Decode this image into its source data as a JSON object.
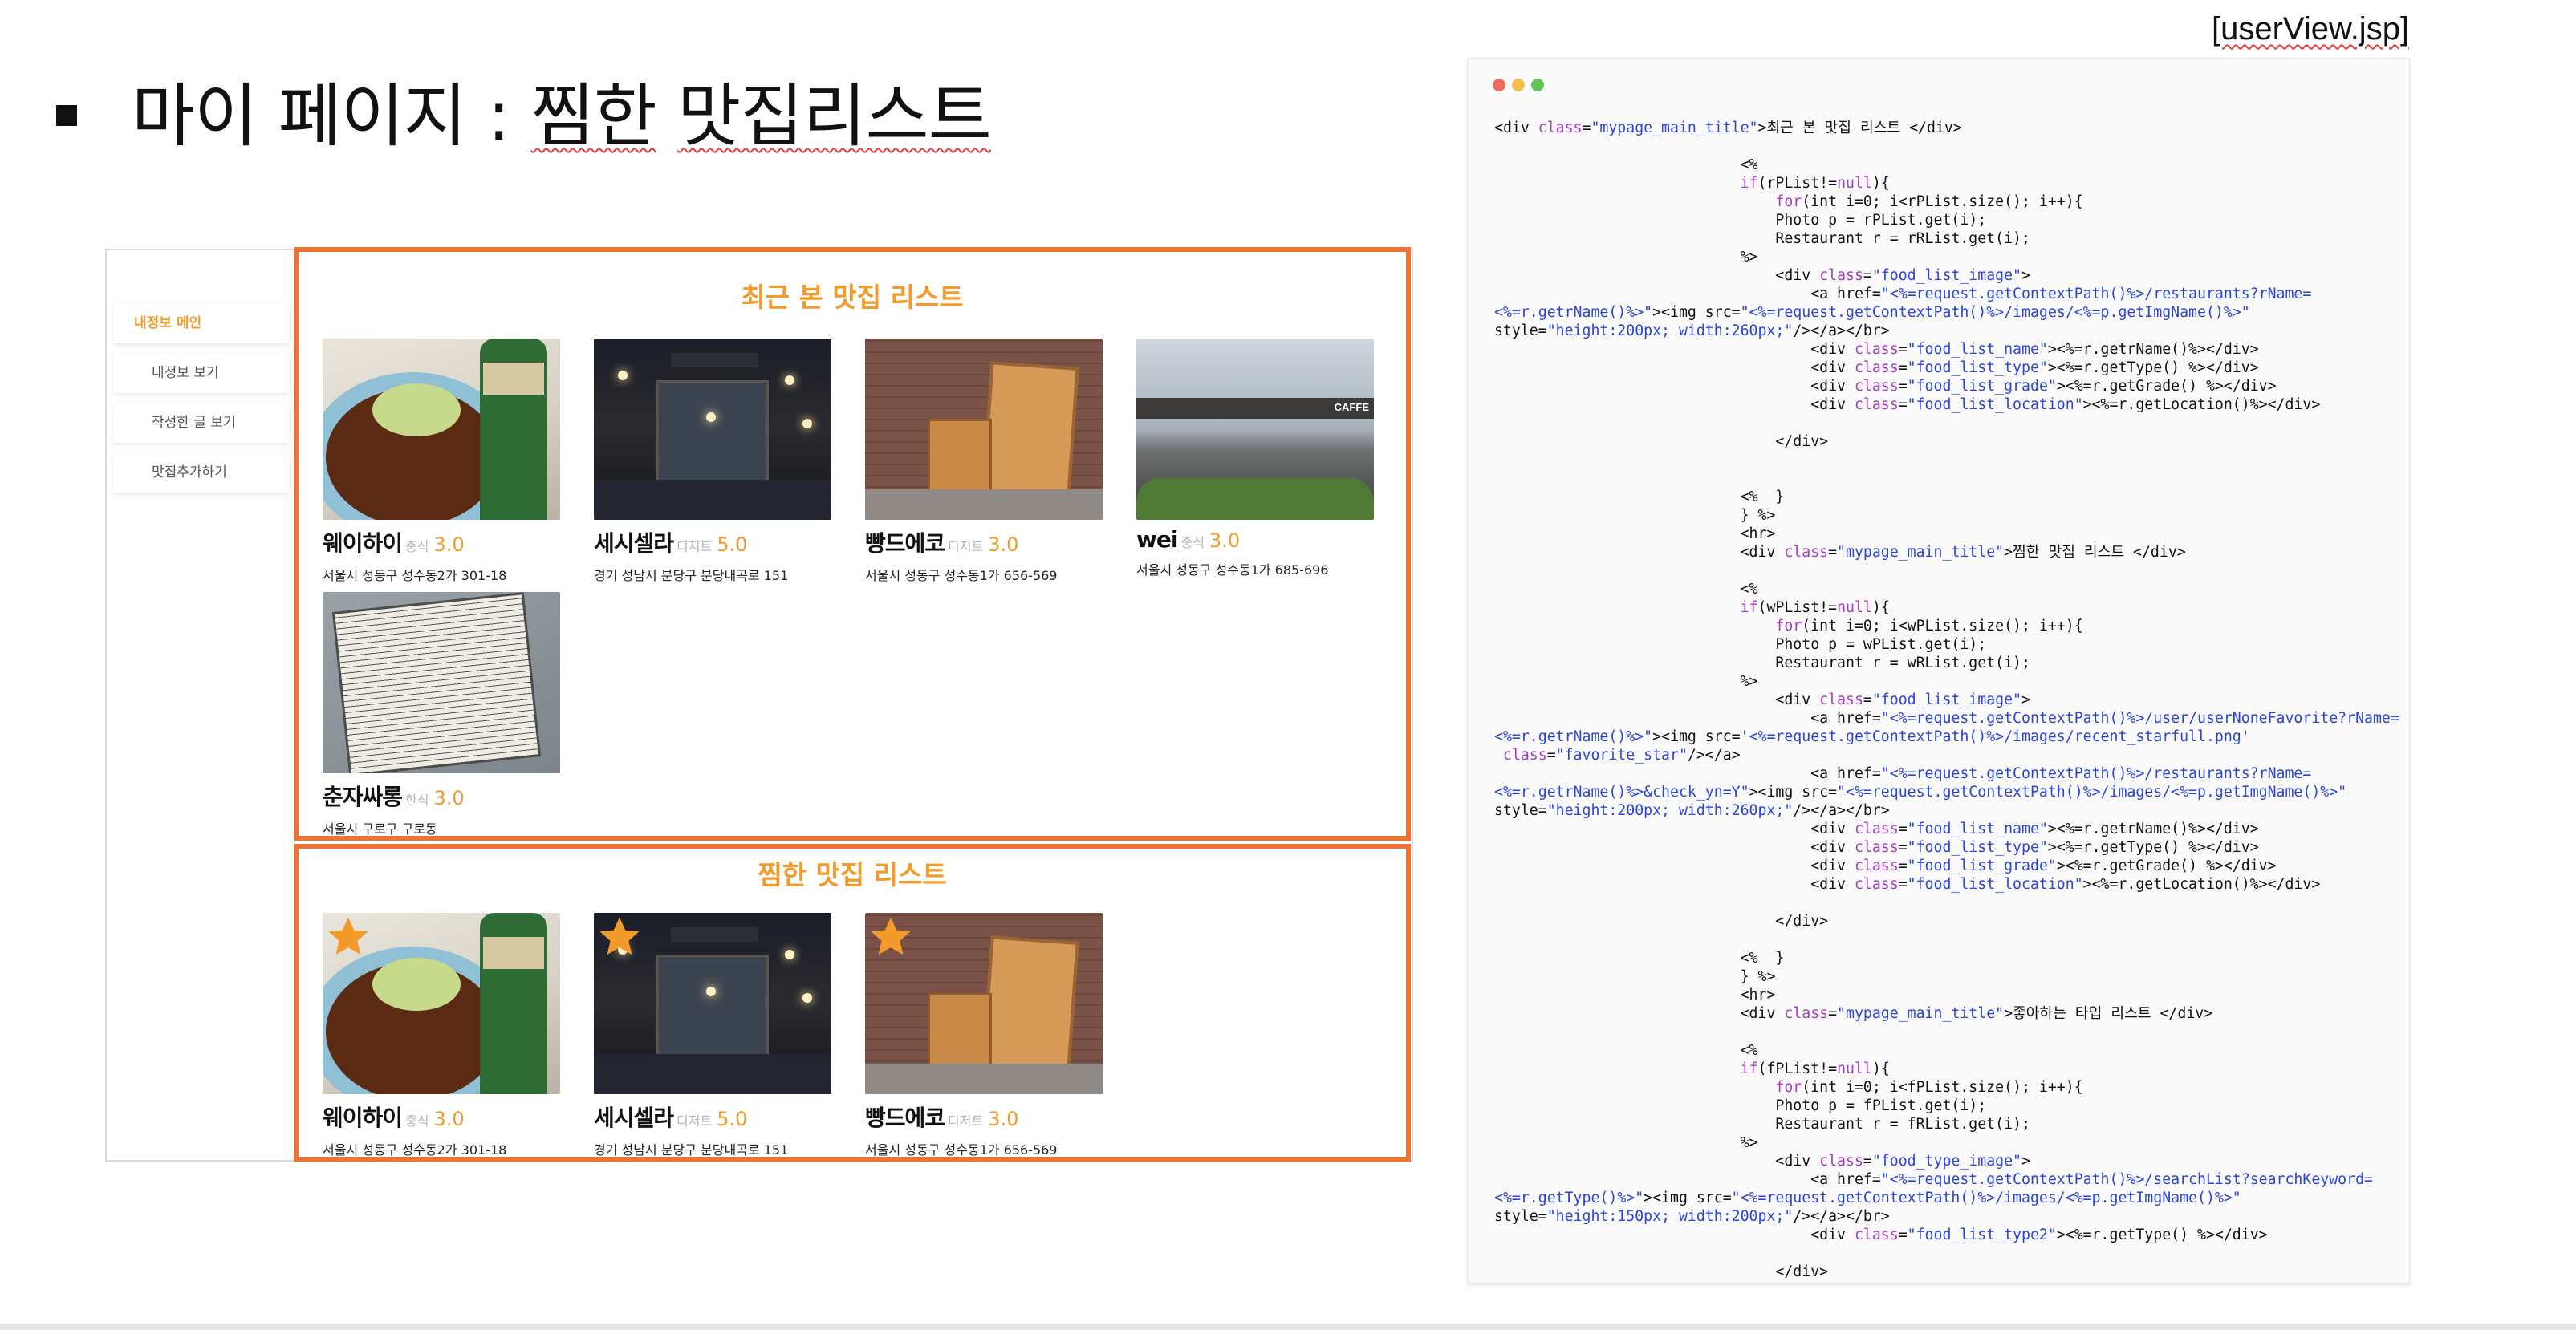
{
  "slide": {
    "file_label": "[userView.jsp]",
    "title_prefix": "마이 페이지 : ",
    "title_word1": "찜한",
    "title_space": " ",
    "title_word2": "맛집리스트"
  },
  "side_menu": [
    {
      "label": "내정보 메인"
    },
    {
      "label": "내정보 보기"
    },
    {
      "label": "작성한 글 보기"
    },
    {
      "label": "맛집추가하기"
    }
  ],
  "recent_list": {
    "title": "최근 본 맛집 리스트",
    "items": [
      {
        "name": "웨이하이",
        "type": "중식",
        "grade": "3.0",
        "location": "서울시 성동구 성수동2가 301-18",
        "photo": "food-photo"
      },
      {
        "name": "세시셀라",
        "type": "디저트",
        "grade": "5.0",
        "location": "경기 성남시 분당구 분당내곡로 151",
        "photo": "bar-photo"
      },
      {
        "name": "빵드에코",
        "type": "디저트",
        "grade": "3.0",
        "location": "서울시 성동구 성수동1가 656-569",
        "photo": "bakery-photo"
      },
      {
        "name": "wei",
        "type": "중식",
        "grade": "3.0",
        "location": "서울시 성동구 성수동1가 685-696",
        "photo": "store-photo"
      },
      {
        "name": "춘자싸롱",
        "type": "한식",
        "grade": "3.0",
        "location": "서울시 구로구 구로동",
        "photo": "menu-photo"
      }
    ]
  },
  "favorite_list": {
    "title": "찜한 맛집 리스트",
    "star_color": "#f29b2a",
    "items": [
      {
        "name": "웨이하이",
        "type": "중식",
        "grade": "3.0",
        "location": "서울시 성동구 성수동2가 301-18",
        "photo": "food-photo"
      },
      {
        "name": "세시셀라",
        "type": "디저트",
        "grade": "5.0",
        "location": "경기 성남시 분당구 분당내곡로 151",
        "photo": "bar-photo"
      },
      {
        "name": "빵드에코",
        "type": "디저트",
        "grade": "3.0",
        "location": "서울시 성동구 성수동1가 656-569",
        "photo": "bakery-photo"
      }
    ]
  },
  "code_window": {
    "dot_colors": [
      "#ee6a5f",
      "#f5be4f",
      "#61c454"
    ],
    "string_color": "#2b45d6",
    "keyword_color": "#a63cc6",
    "lines": [
      [
        [
          "",
          "<div "
        ],
        [
          "k",
          "class"
        ],
        [
          "",
          "="
        ],
        [
          "s",
          "\"mypage_main_title\""
        ],
        [
          "",
          ">최근 본 맛집 리스트 </div>"
        ]
      ],
      [
        [
          "",
          ""
        ]
      ],
      [
        [
          "",
          "                            <%"
        ]
      ],
      [
        [
          "",
          "                            "
        ],
        [
          "k",
          "if"
        ],
        [
          "",
          "(rPList!="
        ],
        [
          "k",
          "null"
        ],
        [
          "",
          "){"
        ]
      ],
      [
        [
          "",
          "                                "
        ],
        [
          "k",
          "for"
        ],
        [
          "",
          "(int i=0; i<rPList.size(); i++){"
        ]
      ],
      [
        [
          "",
          "                                Photo p = rPList.get(i);"
        ]
      ],
      [
        [
          "",
          "                                Restaurant r = rRList.get(i);"
        ]
      ],
      [
        [
          "",
          "                            %>"
        ]
      ],
      [
        [
          "",
          "                                <div "
        ],
        [
          "k",
          "class"
        ],
        [
          "",
          "="
        ],
        [
          "s",
          "\"food_list_image\""
        ],
        [
          "",
          ">"
        ]
      ],
      [
        [
          "",
          "                                    <a href="
        ],
        [
          "s",
          "\"<%=request.getContextPath()%>/restaurants?rName="
        ]
      ],
      [
        [
          "s",
          "<%=r.getrName()%>\""
        ],
        [
          "",
          "><img src="
        ],
        [
          "s",
          "\"<%=request.getContextPath()%>/images/<%=p.getImgName()%>\""
        ]
      ],
      [
        [
          "",
          "style="
        ],
        [
          "s",
          "\"height:200px; width:260px;\""
        ],
        [
          "",
          "/></a></br>"
        ]
      ],
      [
        [
          "",
          "                                    <div "
        ],
        [
          "k",
          "class"
        ],
        [
          "",
          "="
        ],
        [
          "s",
          "\"food_list_name\""
        ],
        [
          "",
          "><%=r.getrName()%></div>"
        ]
      ],
      [
        [
          "",
          "                                    <div "
        ],
        [
          "k",
          "class"
        ],
        [
          "",
          "="
        ],
        [
          "s",
          "\"food_list_type\""
        ],
        [
          "",
          "><%=r.getType() %></div>"
        ]
      ],
      [
        [
          "",
          "                                    <div "
        ],
        [
          "k",
          "class"
        ],
        [
          "",
          "="
        ],
        [
          "s",
          "\"food_list_grade\""
        ],
        [
          "",
          "><%=r.getGrade() %></div>"
        ]
      ],
      [
        [
          "",
          "                                    <div "
        ],
        [
          "k",
          "class"
        ],
        [
          "",
          "="
        ],
        [
          "s",
          "\"food_list_location\""
        ],
        [
          "",
          "><%=r.getLocation()%></div>"
        ]
      ],
      [
        [
          "",
          ""
        ]
      ],
      [
        [
          "",
          "                                </div>"
        ]
      ],
      [
        [
          "",
          ""
        ]
      ],
      [
        [
          "",
          ""
        ]
      ],
      [
        [
          "",
          "                            <%  }"
        ]
      ],
      [
        [
          "",
          "                            } %>"
        ]
      ],
      [
        [
          "",
          "                            <hr>"
        ]
      ],
      [
        [
          "",
          "                            <div "
        ],
        [
          "k",
          "class"
        ],
        [
          "",
          "="
        ],
        [
          "s",
          "\"mypage_main_title\""
        ],
        [
          "",
          ">찜한 맛집 리스트 </div>"
        ]
      ],
      [
        [
          "",
          ""
        ]
      ],
      [
        [
          "",
          "                            <%"
        ]
      ],
      [
        [
          "",
          "                            "
        ],
        [
          "k",
          "if"
        ],
        [
          "",
          "(wPList!="
        ],
        [
          "k",
          "null"
        ],
        [
          "",
          "){"
        ]
      ],
      [
        [
          "",
          "                                "
        ],
        [
          "k",
          "for"
        ],
        [
          "",
          "(int i=0; i<wPList.size(); i++){"
        ]
      ],
      [
        [
          "",
          "                                Photo p = wPList.get(i);"
        ]
      ],
      [
        [
          "",
          "                                Restaurant r = wRList.get(i);"
        ]
      ],
      [
        [
          "",
          "                            %>"
        ]
      ],
      [
        [
          "",
          "                                <div "
        ],
        [
          "k",
          "class"
        ],
        [
          "",
          "="
        ],
        [
          "s",
          "\"food_list_image\""
        ],
        [
          "",
          ">"
        ]
      ],
      [
        [
          "",
          "                                    <a href="
        ],
        [
          "s",
          "\"<%=request.getContextPath()%>/user/userNoneFavorite?rName="
        ]
      ],
      [
        [
          "s",
          "<%=r.getrName()%>\""
        ],
        [
          "",
          "><img src='"
        ],
        [
          "s",
          "<%=request.getContextPath()%>/images/recent_starfull.png'"
        ]
      ],
      [
        [
          "",
          " "
        ],
        [
          "k",
          "class"
        ],
        [
          "",
          "="
        ],
        [
          "s",
          "\"favorite_star\""
        ],
        [
          "",
          "/></a>"
        ]
      ],
      [
        [
          "",
          "                                    <a href="
        ],
        [
          "s",
          "\"<%=request.getContextPath()%>/restaurants?rName="
        ]
      ],
      [
        [
          "s",
          "<%=r.getrName()%>&check_yn=Y\""
        ],
        [
          "",
          "><img src="
        ],
        [
          "s",
          "\"<%=request.getContextPath()%>/images/<%=p.getImgName()%>\""
        ]
      ],
      [
        [
          "",
          "style="
        ],
        [
          "s",
          "\"height:200px; width:260px;\""
        ],
        [
          "",
          "/></a></br>"
        ]
      ],
      [
        [
          "",
          "                                    <div "
        ],
        [
          "k",
          "class"
        ],
        [
          "",
          "="
        ],
        [
          "s",
          "\"food_list_name\""
        ],
        [
          "",
          "><%=r.getrName()%></div>"
        ]
      ],
      [
        [
          "",
          "                                    <div "
        ],
        [
          "k",
          "class"
        ],
        [
          "",
          "="
        ],
        [
          "s",
          "\"food_list_type\""
        ],
        [
          "",
          "><%=r.getType() %></div>"
        ]
      ],
      [
        [
          "",
          "                                    <div "
        ],
        [
          "k",
          "class"
        ],
        [
          "",
          "="
        ],
        [
          "s",
          "\"food_list_grade\""
        ],
        [
          "",
          "><%=r.getGrade() %></div>"
        ]
      ],
      [
        [
          "",
          "                                    <div "
        ],
        [
          "k",
          "class"
        ],
        [
          "",
          "="
        ],
        [
          "s",
          "\"food_list_location\""
        ],
        [
          "",
          "><%=r.getLocation()%></div>"
        ]
      ],
      [
        [
          "",
          ""
        ]
      ],
      [
        [
          "",
          "                                </div>"
        ]
      ],
      [
        [
          "",
          ""
        ]
      ],
      [
        [
          "",
          "                            <%  }"
        ]
      ],
      [
        [
          "",
          "                            } %>"
        ]
      ],
      [
        [
          "",
          "                            <hr>"
        ]
      ],
      [
        [
          "",
          "                            <div "
        ],
        [
          "k",
          "class"
        ],
        [
          "",
          "="
        ],
        [
          "s",
          "\"mypage_main_title\""
        ],
        [
          "",
          ">좋아하는 타입 리스트 </div>"
        ]
      ],
      [
        [
          "",
          ""
        ]
      ],
      [
        [
          "",
          "                            <%"
        ]
      ],
      [
        [
          "",
          "                            "
        ],
        [
          "k",
          "if"
        ],
        [
          "",
          "(fPList!="
        ],
        [
          "k",
          "null"
        ],
        [
          "",
          "){"
        ]
      ],
      [
        [
          "",
          "                                "
        ],
        [
          "k",
          "for"
        ],
        [
          "",
          "(int i=0; i<fPList.size(); i++){"
        ]
      ],
      [
        [
          "",
          "                                Photo p = fPList.get(i);"
        ]
      ],
      [
        [
          "",
          "                                Restaurant r = fRList.get(i);"
        ]
      ],
      [
        [
          "",
          "                            %>"
        ]
      ],
      [
        [
          "",
          "                                <div "
        ],
        [
          "k",
          "class"
        ],
        [
          "",
          "="
        ],
        [
          "s",
          "\"food_type_image\""
        ],
        [
          "",
          ">"
        ]
      ],
      [
        [
          "",
          "                                    <a href="
        ],
        [
          "s",
          "\"<%=request.getContextPath()%>/searchList?searchKeyword="
        ]
      ],
      [
        [
          "s",
          "<%=r.getType()%>\""
        ],
        [
          "",
          "><img src="
        ],
        [
          "s",
          "\"<%=request.getContextPath()%>/images/<%=p.getImgName()%>\""
        ]
      ],
      [
        [
          "",
          "style="
        ],
        [
          "s",
          "\"height:150px; width:200px;\""
        ],
        [
          "",
          "/></a></br>"
        ]
      ],
      [
        [
          "",
          "                                    <div "
        ],
        [
          "k",
          "class"
        ],
        [
          "",
          "="
        ],
        [
          "s",
          "\"food_list_type2\""
        ],
        [
          "",
          "><%=r.getType() %></div>"
        ]
      ],
      [
        [
          "",
          ""
        ]
      ],
      [
        [
          "",
          "                                </div>"
        ]
      ]
    ]
  }
}
